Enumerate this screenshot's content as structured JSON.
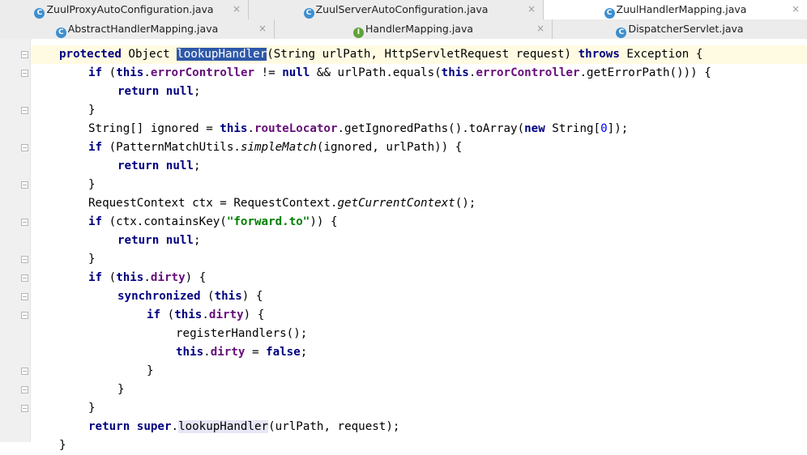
{
  "tabs_row1": [
    {
      "label": "ZuulProxyAutoConfiguration.java",
      "icon": "class-icon",
      "icon_glyph": "C",
      "active": false
    },
    {
      "label": "ZuulServerAutoConfiguration.java",
      "icon": "class-icon",
      "icon_glyph": "C",
      "active": false
    },
    {
      "label": "ZuulHandlerMapping.java",
      "icon": "class-icon",
      "icon_glyph": "C",
      "active": true
    }
  ],
  "tabs_row2": [
    {
      "label": "AbstractHandlerMapping.java",
      "icon": "class-icon",
      "icon_glyph": "C"
    },
    {
      "label": "HandlerMapping.java",
      "icon": "interface-icon",
      "icon_glyph": "I"
    },
    {
      "label": "DispatcherServlet.java",
      "icon": "class-icon",
      "icon_glyph": "C"
    }
  ],
  "close_glyph": "×",
  "code": {
    "l1": {
      "kw1": "protected",
      "t1": " Object ",
      "sel": "lookupHandler",
      "t2": "(String urlPath, HttpServletRequest request) ",
      "kw2": "throws",
      "t3": " Exception {"
    },
    "l2": {
      "kw1": "if",
      "t1": " (",
      "kw2": "this",
      "t2": ".",
      "f1": "errorController",
      "t3": " != ",
      "kw3": "null",
      "t4": " && urlPath.equals(",
      "kw4": "this",
      "t5": ".",
      "f2": "errorController",
      "t6": ".getErrorPath())) {"
    },
    "l3": {
      "kw1": "return",
      "kw2": "null",
      "t1": ";"
    },
    "l4": {
      "t1": "}"
    },
    "l5": {
      "t1": "String[] ignored = ",
      "kw1": "this",
      "t2": ".",
      "f1": "routeLocator",
      "t3": ".getIgnoredPaths().toArray(",
      "kw2": "new",
      "t4": " String[",
      "n1": "0",
      "t5": "]);"
    },
    "l6": {
      "kw1": "if",
      "t1": " (PatternMatchUtils.",
      "i1": "simpleMatch",
      "t2": "(ignored, urlPath)) {"
    },
    "l7": {
      "kw1": "return",
      "kw2": "null",
      "t1": ";"
    },
    "l8": {
      "t1": "}"
    },
    "l9": {
      "t1": "RequestContext ctx = RequestContext.",
      "i1": "getCurrentContext",
      "t2": "();"
    },
    "l10": {
      "kw1": "if",
      "t1": " (ctx.containsKey(",
      "s1": "\"forward.to\"",
      "t2": ")) {"
    },
    "l11": {
      "kw1": "return",
      "kw2": "null",
      "t1": ";"
    },
    "l12": {
      "t1": "}"
    },
    "l13": {
      "kw1": "if",
      "t1": " (",
      "kw2": "this",
      "t2": ".",
      "f1": "dirty",
      "t3": ") {"
    },
    "l14": {
      "kw1": "synchronized",
      "t1": " (",
      "kw2": "this",
      "t2": ") {"
    },
    "l15": {
      "kw1": "if",
      "t1": " (",
      "kw2": "this",
      "t2": ".",
      "f1": "dirty",
      "t3": ") {"
    },
    "l16": {
      "t1": "registerHandlers();"
    },
    "l17": {
      "kw1": "this",
      "t1": ".",
      "f1": "dirty",
      "t2": " = ",
      "kw2": "false",
      "t3": ";"
    },
    "l18": {
      "t1": "}"
    },
    "l19": {
      "t1": "}"
    },
    "l20": {
      "t1": "}"
    },
    "l21": {
      "kw1": "return",
      "t1": " ",
      "kw2": "super",
      "t2": ".",
      "h1": "lookupHandler",
      "t3": "(urlPath, request);"
    },
    "l22": {
      "t1": "}"
    }
  }
}
